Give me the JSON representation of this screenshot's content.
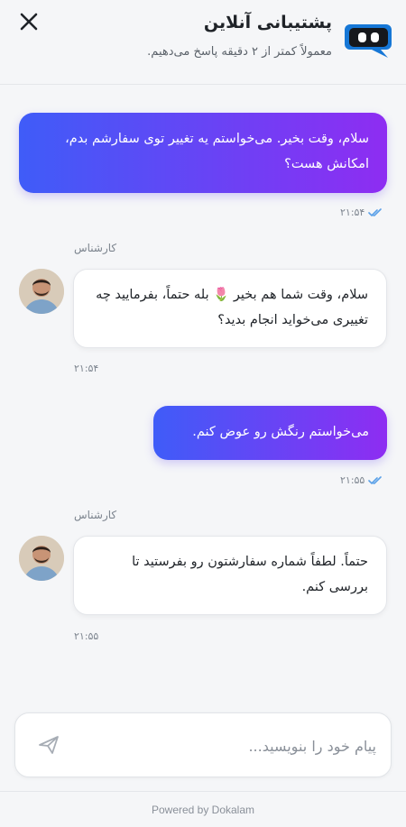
{
  "header": {
    "title": "پشتیبانی آنلاین",
    "subtitle": "معمولاً کمتر از ۲ دقیقه پاسخ می‌دهیم.",
    "close_icon": "close-icon",
    "logo_icon": "chat-bot-icon"
  },
  "colors": {
    "user_gradient_start": "#3f5cf8",
    "user_gradient_end": "#8e2df2",
    "read_tick": "#5aa0e8"
  },
  "messages": [
    {
      "role": "user",
      "text": "سلام، وقت بخیر. می‌خواستم یه تغییر توی سفارشم بدم، امکانش هست؟",
      "time": "۲۱:۵۴",
      "status": "read"
    },
    {
      "role": "agent",
      "sender": "کارشناس",
      "text": "سلام، وقت شما هم بخیر 🌷 بله حتماً، بفرمایید چه تغییری می‌خواید انجام بدید؟",
      "time": "۲۱:۵۴"
    },
    {
      "role": "user",
      "text": "می‌خواستم رنگش رو عوض کنم.",
      "time": "۲۱:۵۵",
      "status": "read"
    },
    {
      "role": "agent",
      "sender": "کارشناس",
      "text": "حتماً. لطفاً شماره سفارشتون رو بفرستید تا بررسی کنم.",
      "time": "۲۱:۵۵"
    }
  ],
  "composer": {
    "placeholder": "پیام خود را بنویسید...",
    "value": "",
    "send_icon": "send-icon"
  },
  "footer": {
    "powered_by": "Powered by Dokalam"
  }
}
